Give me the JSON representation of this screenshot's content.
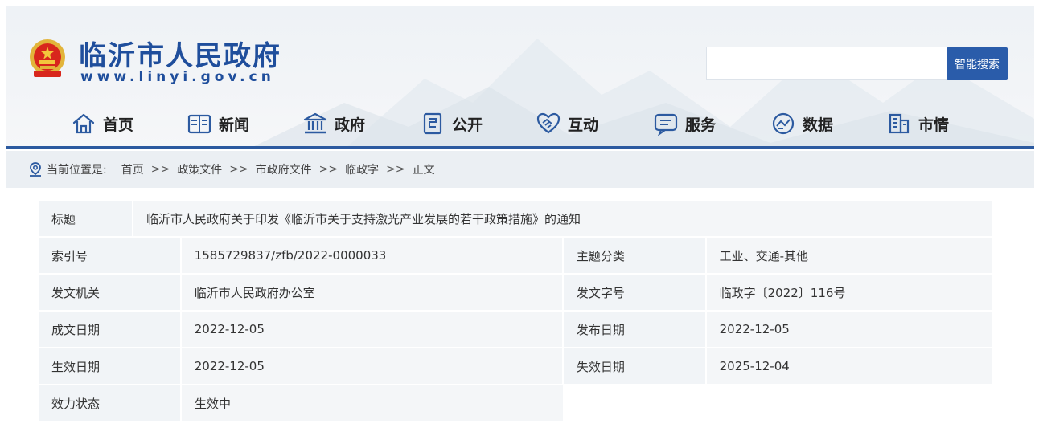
{
  "header": {
    "site_title": "临沂市人民政府",
    "site_domain": "www.linyi.gov.cn",
    "search_button": "智能搜索",
    "brand_color": "#2c5aa0"
  },
  "nav": [
    {
      "label": "首页",
      "icon": "home-icon"
    },
    {
      "label": "新闻",
      "icon": "news-icon"
    },
    {
      "label": "政府",
      "icon": "government-icon"
    },
    {
      "label": "公开",
      "icon": "document-icon"
    },
    {
      "label": "互动",
      "icon": "handshake-icon"
    },
    {
      "label": "服务",
      "icon": "service-icon"
    },
    {
      "label": "数据",
      "icon": "data-icon"
    },
    {
      "label": "市情",
      "icon": "building-icon"
    }
  ],
  "breadcrumb": {
    "prefix": "当前位置是:",
    "separator": ">>",
    "items": [
      "首页",
      "政策文件",
      "市政府文件",
      "临政字",
      "正文"
    ]
  },
  "info": {
    "title_label": "标题",
    "title_value": "临沂市人民政府关于印发《临沂市关于支持激光产业发展的若干政策措施》的通知",
    "rows": [
      {
        "l1": "索引号",
        "v1": "1585729837/zfb/2022-0000033",
        "l2": "主题分类",
        "v2": "工业、交通-其他"
      },
      {
        "l1": "发文机关",
        "v1": "临沂市人民政府办公室",
        "l2": "发文字号",
        "v2": "临政字〔2022〕116号"
      },
      {
        "l1": "成文日期",
        "v1": "2022-12-05",
        "l2": "发布日期",
        "v2": "2022-12-05"
      },
      {
        "l1": "生效日期",
        "v1": "2022-12-05",
        "l2": "失效日期",
        "v2": "2025-12-04"
      }
    ],
    "status_label": "效力状态",
    "status_value": "生效中"
  }
}
